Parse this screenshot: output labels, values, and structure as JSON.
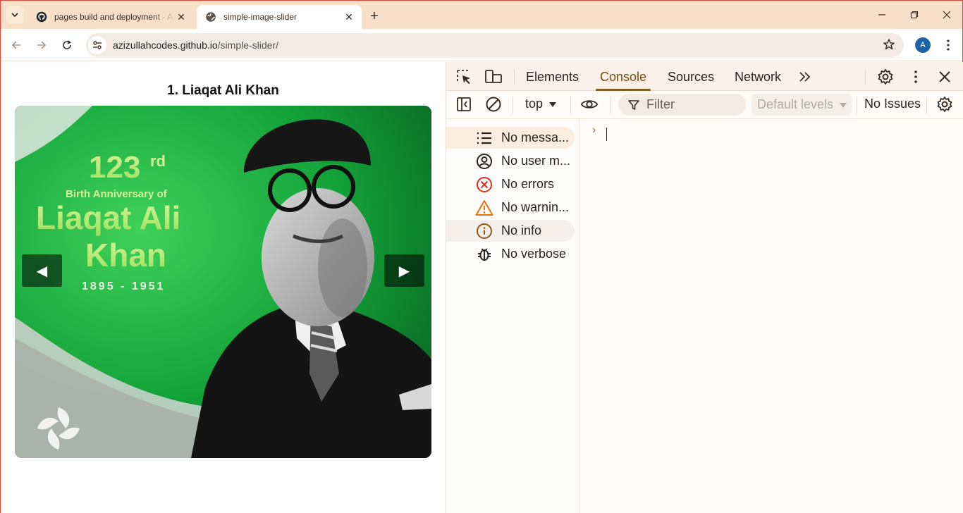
{
  "browser": {
    "tabs": [
      {
        "title": "pages build and deployment · A",
        "icon": "github-icon",
        "active": false
      },
      {
        "title": "simple-image-slider",
        "icon": "globe-icon",
        "active": true
      }
    ],
    "url_host": "azizullahcodes.github.io",
    "url_path": "/simple-slider/",
    "profile_initial": "A"
  },
  "page": {
    "slide_title": "1. Liaqat Ali Khan",
    "slide_image": {
      "ordinal": "123",
      "ordinal_suffix": "rd",
      "subtitle": "Birth Anniversary of",
      "name_line1": "Liaqat Ali",
      "name_line2": "Khan",
      "years": "1895 - 1951"
    },
    "prev_label": "◀",
    "next_label": "▶"
  },
  "devtools": {
    "tabs": [
      "Elements",
      "Console",
      "Sources",
      "Network"
    ],
    "active_tab": "Console",
    "context": "top",
    "filter_placeholder": "Filter",
    "levels_label": "Default levels",
    "issues_label": "No Issues",
    "sidebar": [
      {
        "label": "No messa...",
        "icon": "list-icon"
      },
      {
        "label": "No user m...",
        "icon": "user-circle-icon"
      },
      {
        "label": "No errors",
        "icon": "error-icon"
      },
      {
        "label": "No warnin...",
        "icon": "warning-icon"
      },
      {
        "label": "No info",
        "icon": "info-icon"
      },
      {
        "label": "No verbose",
        "icon": "bug-icon"
      }
    ],
    "prompt_symbol": "›"
  },
  "colors": {
    "tabstrip": "#f9dfc7",
    "devtools_accent": "#8a5a1c",
    "error": "#d93025",
    "warning": "#e8710a",
    "info": "#8a5a1c",
    "avatar": "#1e62a8"
  }
}
